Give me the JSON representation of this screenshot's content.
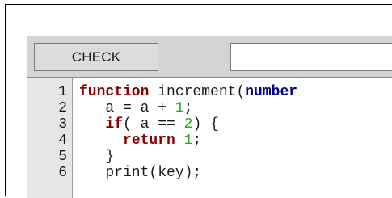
{
  "toolbar": {
    "check_label": "CHECK",
    "answer_value": ""
  },
  "code_lines": [
    {
      "number": "1",
      "tokens": [
        {
          "text": "function",
          "kind": "keyword"
        },
        {
          "text": " increment(",
          "kind": "plain"
        },
        {
          "text": "number",
          "kind": "type"
        }
      ]
    },
    {
      "number": "2",
      "tokens": [
        {
          "text": "   a = a + ",
          "kind": "plain"
        },
        {
          "text": "1",
          "kind": "number"
        },
        {
          "text": ";",
          "kind": "plain"
        }
      ]
    },
    {
      "number": "3",
      "tokens": [
        {
          "text": "   ",
          "kind": "plain"
        },
        {
          "text": "if",
          "kind": "keyword"
        },
        {
          "text": "( a == ",
          "kind": "plain"
        },
        {
          "text": "2",
          "kind": "number"
        },
        {
          "text": ") {",
          "kind": "plain"
        }
      ]
    },
    {
      "number": "4",
      "tokens": [
        {
          "text": "     ",
          "kind": "plain"
        },
        {
          "text": "return",
          "kind": "keyword"
        },
        {
          "text": " ",
          "kind": "plain"
        },
        {
          "text": "1",
          "kind": "number"
        },
        {
          "text": ";",
          "kind": "plain"
        }
      ]
    },
    {
      "number": "5",
      "tokens": [
        {
          "text": "   }",
          "kind": "plain"
        }
      ]
    },
    {
      "number": "6",
      "tokens": [
        {
          "text": "   print(key);",
          "kind": "plain"
        }
      ]
    }
  ],
  "colors": {
    "keyword": "#8b0000",
    "type": "#00008b",
    "number": "#22aa22",
    "gutter": "#e6e6e6",
    "panel": "#d4d4d4"
  }
}
